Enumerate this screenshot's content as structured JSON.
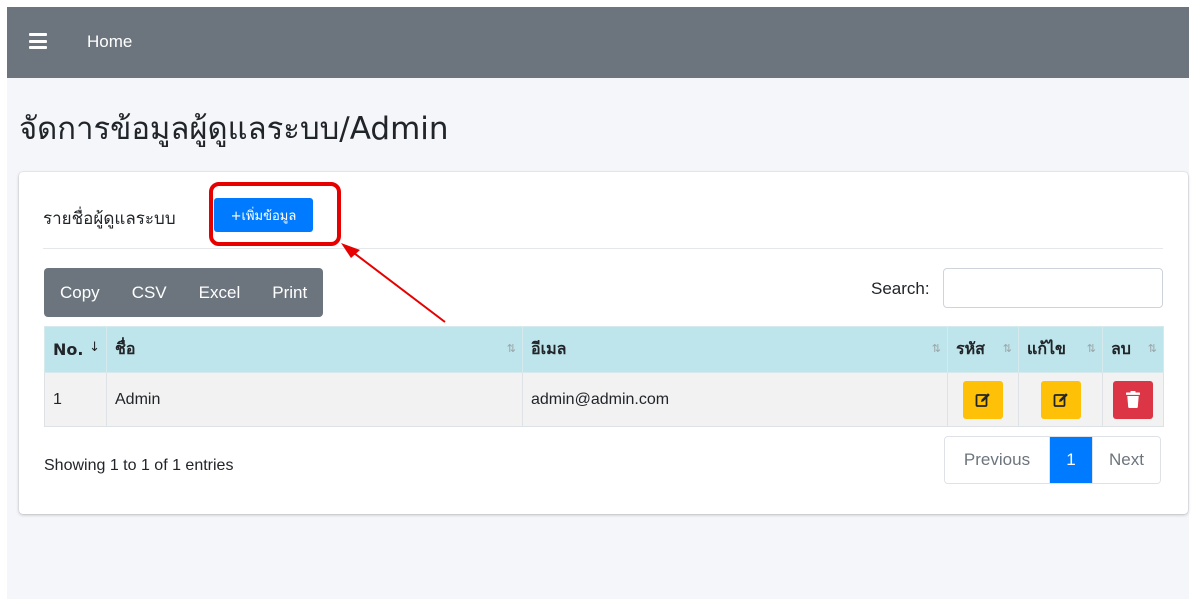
{
  "navbar": {
    "home_label": "Home"
  },
  "page": {
    "title": "จัดการข้อมูลผู้ดูแลระบบ/Admin"
  },
  "card": {
    "header_title": "รายชื่อผู้ดูแลระบบ",
    "add_button_label": "+เพิ่มข้อมูล"
  },
  "toolbar": {
    "buttons": [
      "Copy",
      "CSV",
      "Excel",
      "Print"
    ],
    "search_label": "Search:",
    "search_value": ""
  },
  "table": {
    "columns": [
      "No.",
      "ชื่อ",
      "อีเมล",
      "รหัส",
      "แก้ไข",
      "ลบ"
    ],
    "rows": [
      {
        "no": "1",
        "name": "Admin",
        "email": "admin@admin.com"
      }
    ]
  },
  "footer": {
    "info": "Showing 1 to 1 of 1 entries",
    "previous_label": "Previous",
    "current_page": "1",
    "next_label": "Next"
  },
  "colors": {
    "navbar": "#6c757d",
    "primary": "#007bff",
    "warning": "#ffc107",
    "danger": "#dc3545",
    "table_header": "#bee5eb",
    "annotation": "#e60000"
  },
  "icons": {
    "menu": "hamburger-icon",
    "password": "edit-icon",
    "edit": "edit-icon",
    "delete": "trash-icon"
  }
}
